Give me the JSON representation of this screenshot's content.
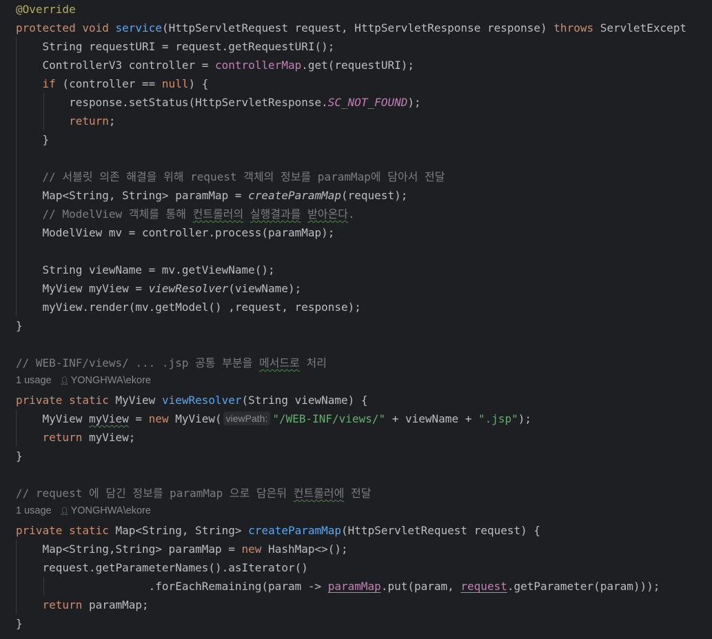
{
  "editor": {
    "lines": {
      "l1": [
        "@Override"
      ],
      "l2": [
        "protected",
        " ",
        "void",
        " ",
        "service",
        "(HttpServletRequest request, HttpServletResponse response) ",
        "throws",
        " ServletExcept"
      ],
      "l3": [
        "    String requestURI = request.getRequestURI();"
      ],
      "l4": [
        "    ControllerV3 controller = ",
        "controllerMap",
        ".get(requestURI);"
      ],
      "l5": [
        "    ",
        "if",
        " (controller == ",
        "null",
        ") {"
      ],
      "l6": [
        "        response.setStatus(HttpServletResponse.",
        "SC_NOT_FOUND",
        ");"
      ],
      "l7": [
        "        ",
        "return",
        ";"
      ],
      "l8": [
        "    }"
      ],
      "l10": [
        "    // 서블릿 의존 해결을 위해 request 객체의 정보를 paramMap에 담아서 전달"
      ],
      "l11": [
        "    Map<String, String> paramMap = ",
        "createParamMap",
        "(request);"
      ],
      "l12": [
        "    // ModelView 객체를 통해 ",
        "컨트롤러의",
        " ",
        "실행결과를",
        " ",
        "받아온다",
        "."
      ],
      "l13": [
        "    ModelView mv = controller.process(paramMap);"
      ],
      "l15": [
        "    String viewName = mv.getViewName();"
      ],
      "l16": [
        "    MyView myView = ",
        "viewResolver",
        "(viewName);"
      ],
      "l17": [
        "    myView.render(mv.getModel() ,request, response);"
      ],
      "l18": [
        "}"
      ],
      "l20": [
        "// WEB-INF/views/ ... .jsp 공통 부분을 ",
        "메서드로",
        " 처리"
      ],
      "l21": [
        "private",
        " ",
        "static",
        " MyView ",
        "viewResolver",
        "(String viewName) {"
      ],
      "l22": [
        "    MyView ",
        "myView",
        " = ",
        "new",
        " MyView(",
        "\"/WEB-INF/views/\"",
        " + viewName + ",
        "\".jsp\"",
        ");"
      ],
      "l23": [
        "    ",
        "return",
        " myView;"
      ],
      "l24": [
        "}"
      ],
      "l26": [
        "// request 에 담긴 정보를 paramMap 으로 담은뒤 ",
        "컨트롤러에",
        " 전달"
      ],
      "l27": [
        "private",
        " ",
        "static",
        " Map<String, String> ",
        "createParamMap",
        "(HttpServletRequest request) {"
      ],
      "l28": [
        "    Map<String,String> paramMap = ",
        "new",
        " HashMap<>();"
      ],
      "l29": [
        "    request.getParameterNames().asIterator()"
      ],
      "l30": [
        "                    .forEachRemaining(param -> ",
        "paramMap",
        ".put(param, ",
        "request",
        ".getParameter(param)));"
      ],
      "l31": [
        "    ",
        "return",
        " paramMap;"
      ],
      "l32": [
        "}"
      ]
    },
    "paramMapWord": "paramMap",
    "paramMapSuffix": "에",
    "inlay_param_hint": "viewPath:",
    "usage_hints": [
      {
        "usages": "1 usage",
        "author": "YONGHWA\\ekore"
      },
      {
        "usages": "1 usage",
        "author": "YONGHWA\\ekore"
      }
    ],
    "author_icon": "person-icon"
  }
}
